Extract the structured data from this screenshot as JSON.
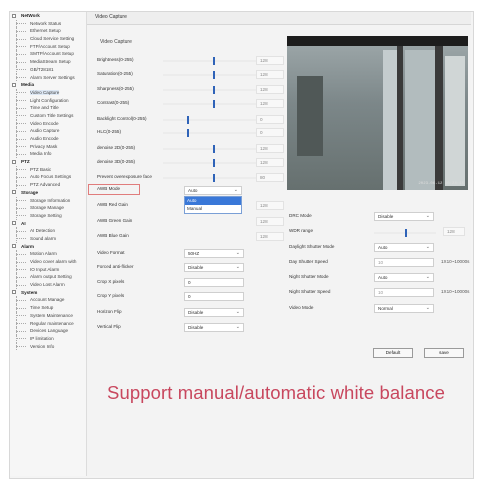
{
  "sidebar": {
    "groups": [
      {
        "title": "NetWork",
        "items": [
          "Network Status",
          "Ethernet Setup",
          "Cloud Service Setting",
          "FTP/Account Setup",
          "SMTP/Account Setup",
          "MediaStream Setup",
          "GB/T28181",
          "Alarm Server Settings"
        ]
      },
      {
        "title": "Media",
        "items": [
          "Video Capture",
          "Light Configuration",
          "Time and Title",
          "Custom Title Settings",
          "Video Encode",
          "Audio Capture",
          "Audio Encode",
          "Privacy Mask",
          "Media Info"
        ]
      },
      {
        "title": "PTZ",
        "items": [
          "PTZ Basic",
          "Auto Focus Settings",
          "PTZ Advanced"
        ]
      },
      {
        "title": "Storage",
        "items": [
          "Storage Information",
          "Storage Manage",
          "Storage Setting"
        ]
      },
      {
        "title": "AI",
        "items": [
          "AI Detection",
          "Sound alarm"
        ]
      },
      {
        "title": "Alarm",
        "items": [
          "Motion Alarm",
          "Video cover alarm with",
          "IO Input Alarm",
          "Alarm output Setting",
          "Video Lost Alarm"
        ]
      },
      {
        "title": "System",
        "items": [
          "Account Manage",
          "Time Setup",
          "System Maintenance",
          "Regular maintenance",
          "Devices Language",
          "IP limitation",
          "Version Info"
        ]
      }
    ]
  },
  "main": {
    "tab": "Video Capture",
    "section_title": "Video Capture",
    "sliders": [
      {
        "label": "Brightness(0-255)",
        "value": "128",
        "level": 0.5
      },
      {
        "label": "Saturation(0-255)",
        "value": "128",
        "level": 0.5
      },
      {
        "label": "Sharpness(0-255)",
        "value": "128",
        "level": 0.5
      },
      {
        "label": "Contrast(0-255)",
        "value": "128",
        "level": 0.5
      },
      {
        "label": "Backlight Control(0-255)",
        "value": "0",
        "level": 0.0
      },
      {
        "label": "HLC(0-255)",
        "value": "0",
        "level": 0.0
      },
      {
        "label": "denoise 2D(0-255)",
        "value": "128",
        "level": 0.5
      },
      {
        "label": "denoise 3D(0-255)",
        "value": "128",
        "level": 0.5
      },
      {
        "label": "Prevent overexposure face",
        "value": "80",
        "level": 0.5
      }
    ],
    "awb": {
      "mode_label": "AWB Mode",
      "mode_value": "Auto",
      "options": [
        "Auto",
        "Manual"
      ],
      "red_label": "AWB Red Gain",
      "red_value": "128",
      "green_label": "AWB Green Gain",
      "green_value": "128",
      "blue_label": "AWB Blue Gain",
      "blue_value": "128"
    },
    "left_fields": [
      {
        "label": "Video Format",
        "value": "50HZ",
        "type": "select"
      },
      {
        "label": "Forced anti-flicker",
        "value": "Disable",
        "type": "select"
      },
      {
        "label": "Crop X pixels",
        "value": "0",
        "type": "input"
      },
      {
        "label": "Crop Y pixels",
        "value": "0",
        "type": "input"
      },
      {
        "label": "Horizon Flip",
        "value": "Disable",
        "type": "select"
      },
      {
        "label": "Vertical Flip",
        "value": "Disable",
        "type": "select"
      }
    ],
    "right_fields": {
      "drc_label": "DRC Mode",
      "drc_value": "Disable",
      "wdr_label": "WDR range",
      "wdr_level": 0.5,
      "wdr_value": "128",
      "day_shutter_mode_label": "Daylight Shutter Mode",
      "day_shutter_mode_value": "Auto",
      "day_shutter_speed_label": "Day Shutter Speed",
      "day_shutter_speed_value": "10",
      "day_unit": "1X10~10000s",
      "night_shutter_mode_label": "Night Shutter Mode",
      "night_shutter_mode_value": "Auto",
      "night_shutter_speed_label": "Night Shutter Speed",
      "night_shutter_speed_value": "10",
      "night_unit": "1X10~10000s",
      "video_mode_label": "Video Mode",
      "video_mode_value": "Normal"
    },
    "buttons": {
      "default": "Default",
      "save": "save"
    },
    "video": {
      "timestamp": "2023-06-12 10:24:15"
    }
  },
  "caption": "Support manual/automatic white balance",
  "colors": {
    "accent": "#2f63b8",
    "caption": "#c8475e",
    "highlight": "#e07c7c"
  }
}
